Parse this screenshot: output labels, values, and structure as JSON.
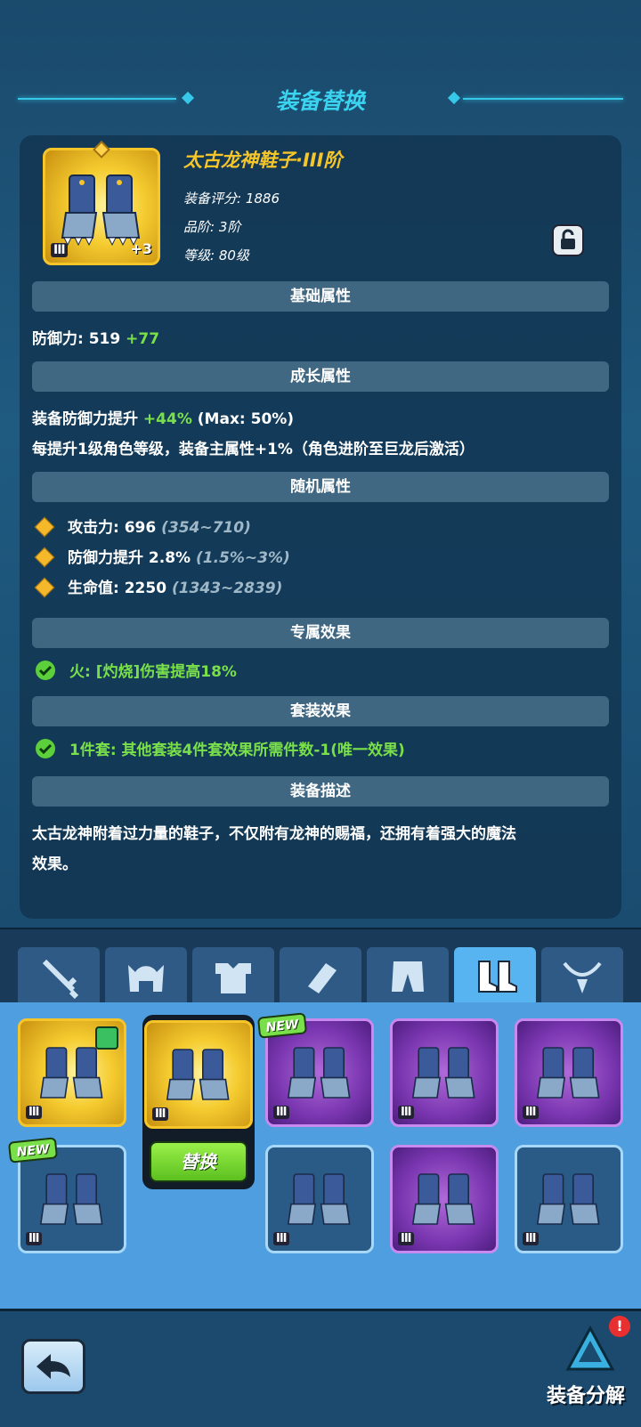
{
  "header": {
    "title": "装备替换"
  },
  "equipment": {
    "name": "太古龙神鞋子·III阶",
    "score": "装备评分: 1886",
    "grade": "品阶: 3阶",
    "level": "等级: 80级",
    "tier_badge": "III",
    "plus": "+3",
    "lock_icon": "lock-open-icon"
  },
  "sections": {
    "basic": "基础属性",
    "growth": "成长属性",
    "random": "随机属性",
    "exclusive": "专属效果",
    "set": "套装效果",
    "desc": "装备描述"
  },
  "basic": {
    "label": "防御力: 519",
    "bonus": "+77"
  },
  "growth": {
    "line1_label": "装备防御力提升",
    "line1_value": "+44%",
    "line1_max": "(Max: 50%)",
    "line2": "每提升1级角色等级，装备主属性+1%（角色进阶至巨龙后激活）"
  },
  "random": [
    {
      "label": "攻击力: 696",
      "range": "(354~710)"
    },
    {
      "label": "防御力提升 2.8%",
      "range": "(1.5%~3%)"
    },
    {
      "label": "生命值: 2250",
      "range": "(1343~2839)"
    }
  ],
  "exclusive": {
    "text": "火: [灼烧]伤害提高18%"
  },
  "set": {
    "text": "1件套: 其他套装4件套效果所需件数-1(唯一效果)"
  },
  "description": {
    "line1": "太古龙神附着过力量的鞋子，不仅附有龙神的赐福，还拥有着强大的魔法",
    "line2": "效果。"
  },
  "tabs": [
    "sword-icon",
    "helmet-icon",
    "armor-icon",
    "bracer-icon",
    "pants-icon",
    "boots-icon",
    "necklace-icon"
  ],
  "active_tab": "boots-icon",
  "inventory": {
    "tier_badge": "III",
    "new_badge": "NEW",
    "replace_label": "替换"
  },
  "bottom": {
    "decompose_label": "装备分解",
    "alert": "!"
  },
  "colors": {
    "accent": "#3ad3f0",
    "gold": "#f5c52a",
    "green": "#7ae04a",
    "purple": "#7a36b0"
  }
}
